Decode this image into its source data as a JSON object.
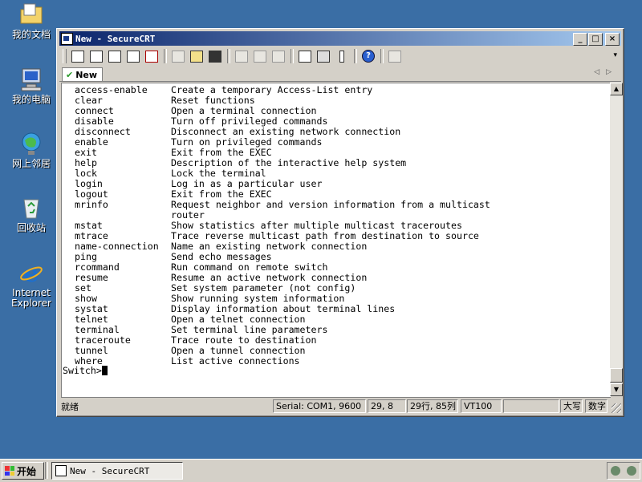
{
  "desktop": {
    "icons": [
      {
        "label": "我的文档",
        "icon": "folder-documents-icon"
      },
      {
        "label": "我的电脑",
        "icon": "computer-icon"
      },
      {
        "label": "网上邻居",
        "icon": "network-icon"
      },
      {
        "label": "回收站",
        "icon": "recycle-bin-icon"
      },
      {
        "label": "Internet Explorer",
        "icon": "internet-explorer-icon"
      }
    ]
  },
  "window": {
    "title": "New - SecureCRT",
    "tab_label": "New"
  },
  "terminal": {
    "lines": [
      {
        "cmd": "access-enable",
        "desc": "Create a temporary Access-List entry"
      },
      {
        "cmd": "clear",
        "desc": "Reset functions"
      },
      {
        "cmd": "connect",
        "desc": "Open a terminal connection"
      },
      {
        "cmd": "disable",
        "desc": "Turn off privileged commands"
      },
      {
        "cmd": "disconnect",
        "desc": "Disconnect an existing network connection"
      },
      {
        "cmd": "enable",
        "desc": "Turn on privileged commands"
      },
      {
        "cmd": "exit",
        "desc": "Exit from the EXEC"
      },
      {
        "cmd": "help",
        "desc": "Description of the interactive help system"
      },
      {
        "cmd": "lock",
        "desc": "Lock the terminal"
      },
      {
        "cmd": "login",
        "desc": "Log in as a particular user"
      },
      {
        "cmd": "logout",
        "desc": "Exit from the EXEC"
      },
      {
        "cmd": "mrinfo",
        "desc": "Request neighbor and version information from a multicast"
      },
      {
        "cmd": "",
        "desc": "router"
      },
      {
        "cmd": "mstat",
        "desc": "Show statistics after multiple multicast traceroutes"
      },
      {
        "cmd": "mtrace",
        "desc": "Trace reverse multicast path from destination to source"
      },
      {
        "cmd": "name-connection",
        "desc": "Name an existing network connection"
      },
      {
        "cmd": "ping",
        "desc": "Send echo messages"
      },
      {
        "cmd": "rcommand",
        "desc": "Run command on remote switch"
      },
      {
        "cmd": "resume",
        "desc": "Resume an active network connection"
      },
      {
        "cmd": "set",
        "desc": "Set system parameter (not config)"
      },
      {
        "cmd": "show",
        "desc": "Show running system information"
      },
      {
        "cmd": "systat",
        "desc": "Display information about terminal lines"
      },
      {
        "cmd": "telnet",
        "desc": "Open a telnet connection"
      },
      {
        "cmd": "terminal",
        "desc": "Set terminal line parameters"
      },
      {
        "cmd": "traceroute",
        "desc": "Trace route to destination"
      },
      {
        "cmd": "tunnel",
        "desc": "Open a tunnel connection"
      },
      {
        "cmd": "where",
        "desc": "List active connections"
      }
    ],
    "prompt": "Switch>"
  },
  "statusbar": {
    "ready": "就绪",
    "serial": "Serial: COM1, 9600",
    "cursor_pos": "29,  8",
    "rows_cols": "29行, 85列",
    "emulation": "VT100",
    "blank": "",
    "caps": "大写",
    "num": "数字"
  },
  "taskbar": {
    "start_label": "开始",
    "task_label": "New - SecureCRT"
  }
}
